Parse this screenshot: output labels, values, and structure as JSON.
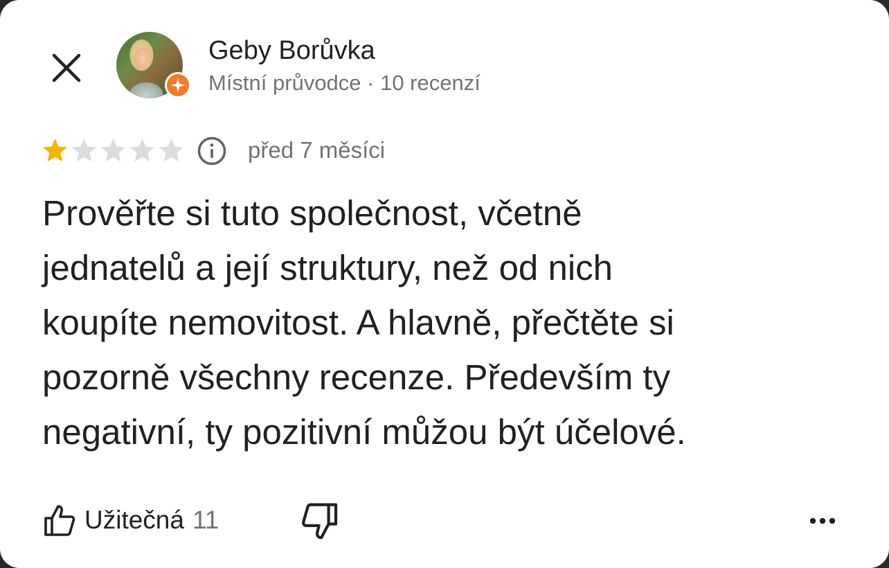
{
  "reviewer": {
    "name": "Geby Borůvka",
    "meta": "Místní průvodce · 10 recenzí"
  },
  "review": {
    "rating": 1,
    "max_rating": 5,
    "date": "před 7 měsíci",
    "text": "Prověřte si tuto společnost, včetně\njednatelů a její struktury, než od nich\nkoupíte nemovitost. A hlavně, přečtěte si\npozorně všechny recenze. Především  ty\nnegativní, ty pozitivní můžou být účelové."
  },
  "actions": {
    "helpful_label": "Užitečná",
    "helpful_count": "11"
  },
  "colors": {
    "star_filled": "#F4B400",
    "star_empty": "#DADCE0",
    "guide_badge": "#F07B28",
    "text_primary": "#202124",
    "text_secondary": "#6F7378"
  },
  "icons": {
    "close": "close-icon",
    "guide_badge": "local-guide-star-icon",
    "info": "info-icon",
    "helpful": "thumbs-up-icon",
    "not_helpful": "thumbs-down-icon",
    "more": "more-options-icon"
  }
}
